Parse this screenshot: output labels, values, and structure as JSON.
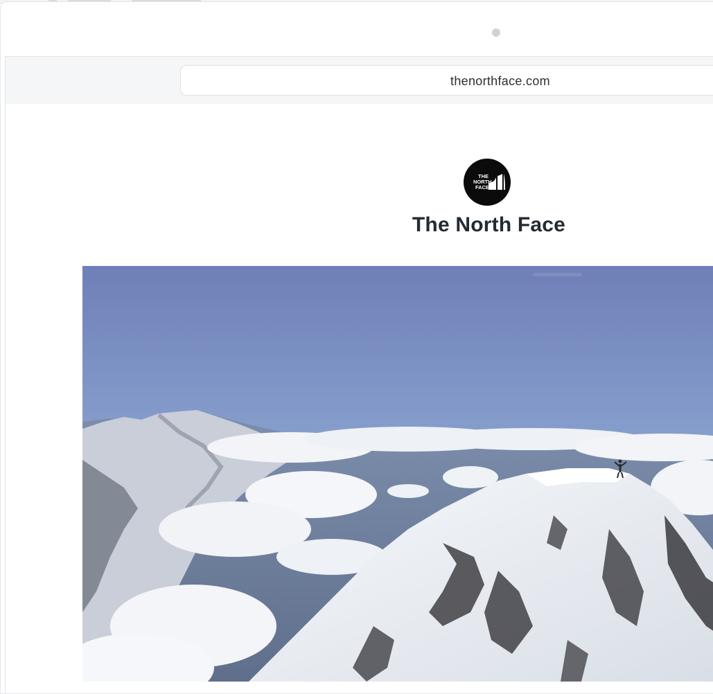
{
  "browser": {
    "url": "thenorthface.com"
  },
  "brand": {
    "name": "The North Face",
    "logo_icon": "the-north-face-logo-icon",
    "logo_lines": [
      "THE",
      "NORTH",
      "FACE"
    ]
  },
  "hero": {
    "icon": "mountain-summit-photo"
  },
  "colors": {
    "page_background": "#ffffff",
    "toolbar_background": "#f5f6f8",
    "title_text": "#242a33",
    "logo_background": "#0b0b0b",
    "sky_top": "#6f7fb8",
    "sky_bottom": "#a9c6df"
  }
}
